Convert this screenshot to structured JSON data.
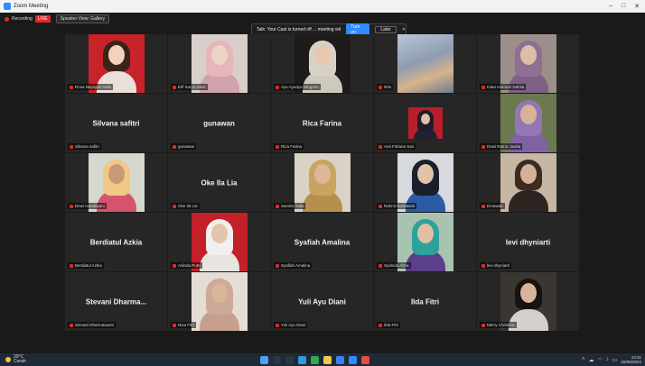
{
  "window": {
    "title": "Zoom Meeting",
    "controls": [
      "–",
      "□",
      "✕"
    ]
  },
  "topbar": {
    "recording_label": "Recording",
    "live_label": "LIVE",
    "view_label": "Speaker View: Gallery"
  },
  "notification": {
    "message": "Talk: Your Cast is turned off ... meeting video",
    "primary_label": "Turn on",
    "secondary_label": "Later",
    "close": "✕"
  },
  "speaker_hint": "",
  "tiles": [
    {
      "name": "",
      "label": "Rosa Naysyas Aulia",
      "video": true,
      "bg": "#c8222a",
      "skin": "#f1d2bd",
      "hair": "#3a2418",
      "hijab": null,
      "cloth": "#e9e0da"
    },
    {
      "name": "",
      "label": "Elif Surya Dewi",
      "video": true,
      "bg": "#d7cfca",
      "skin": "#edd3c3",
      "hair": null,
      "hijab": "#e7b5bb",
      "cloth": "#cfa2ad"
    },
    {
      "name": "",
      "label": "Ayu Ayudya Ningrum",
      "video": true,
      "bg": "#1f1b1a",
      "skin": "#e8c7ae",
      "hair": null,
      "hijab": "#d8d2c6",
      "cloth": "#cfc9bd"
    },
    {
      "name": "",
      "label": "Ikhs",
      "video": true,
      "bg": "#8e9cb2",
      "skin": null,
      "hair": null,
      "hijab": null,
      "cloth": null
    },
    {
      "name": "",
      "label": "Intan Harnum Dahlia",
      "video": true,
      "bg": "#9c8e88",
      "skin": "#ddbea7",
      "hair": null,
      "hijab": "#8f6f94",
      "cloth": "#7e5f86"
    },
    {
      "name": "Silvana safitri",
      "label": "Silvana safitri",
      "video": false
    },
    {
      "name": "gunawan",
      "label": "gunawan",
      "video": false
    },
    {
      "name": "Rica Farina",
      "label": "Rica Farina",
      "video": false
    },
    {
      "name": "",
      "label": "Anti Fitriana Sari",
      "video": true,
      "bg": "#b81f2a",
      "skin": "#e2c1a8",
      "hair": null,
      "hijab": "#1d1d2e",
      "cloth": "#22222e",
      "small": true
    },
    {
      "name": "",
      "label": "Dewi Ratna Juwita",
      "video": true,
      "bg": "#6b7a4e",
      "skin": "#d8b398",
      "hair": null,
      "hijab": "#9476b6",
      "cloth": "#8062a4"
    },
    {
      "name": "",
      "label": "Dewi Handayani",
      "video": true,
      "bg": "#d6d8d0",
      "skin": "#c99a78",
      "hair": null,
      "hijab": "#f1c886",
      "cloth": "#d5546b"
    },
    {
      "name": "Oke Ila Lia",
      "label": "Oke Ila Lia",
      "video": false
    },
    {
      "name": "",
      "label": "Sandra Yulia",
      "video": true,
      "bg": "#d9d3c5",
      "skin": "#dbb899",
      "hair": null,
      "hijab": "#c9a460",
      "cloth": "#b58f4e"
    },
    {
      "name": "",
      "label": "Rahmi Novitasari",
      "video": true,
      "bg": "#d7d9de",
      "skin": "#e2c3aa",
      "hair": null,
      "hijab": "#1a1f2c",
      "cloth": "#2d5aa5"
    },
    {
      "name": "",
      "label": "Ernawati",
      "video": true,
      "bg": "#c7b6a3",
      "skin": "#d4b19a",
      "hair": "#3c2b20",
      "hijab": null,
      "cloth": "#2c2522"
    },
    {
      "name": "Berdiatul Azkia",
      "label": "Berdiatul Azkia",
      "video": false
    },
    {
      "name": "",
      "label": "Adinda Putri",
      "video": true,
      "bg": "#c3202a",
      "skin": "#e3c4ac",
      "hair": null,
      "hijab": "#f2f0ee",
      "cloth": "#e8e4e0"
    },
    {
      "name": "Syafiah Amalina",
      "label": "Syafiah Amalina",
      "video": false
    },
    {
      "name": "",
      "label": "Syahida Aitha",
      "video": true,
      "bg": "#a9c3b1",
      "skin": "#e0bfa5",
      "hair": null,
      "hijab": "#2da19a",
      "cloth": "#5b3f8a"
    },
    {
      "name": "levi dhyniarti",
      "label": "levi dhyniarti",
      "video": false
    },
    {
      "name": "Stevani Dharma...",
      "label": "Stevani Dharmawanti",
      "video": false
    },
    {
      "name": "",
      "label": "Nisa Fitri",
      "video": true,
      "bg": "#e3ddd6",
      "skin": "#d9b497",
      "hair": null,
      "hijab": "#ccaa9a",
      "cloth": "#c79f8f"
    },
    {
      "name": "Yuli Ayu Diani",
      "label": "Yuli Ayu Diani",
      "video": false
    },
    {
      "name": "Ilda Fitri",
      "label": "Ilda Fitri",
      "video": false
    },
    {
      "name": "",
      "label": "Merry Christina",
      "video": true,
      "bg": "#3a3632",
      "skin": "#d7b49a",
      "hair": "#161311",
      "hijab": null,
      "cloth": "#d4d0cc"
    }
  ],
  "taskbar": {
    "weather_temp": "29°C",
    "weather_desc": "Cerah",
    "apps": [
      {
        "name": "start",
        "color": "#4aa3f0"
      },
      {
        "name": "search",
        "color": "#2a3644"
      },
      {
        "name": "taskview",
        "color": "#2a3644"
      },
      {
        "name": "edge",
        "color": "#2e9be0"
      },
      {
        "name": "chrome",
        "color": "#34a853"
      },
      {
        "name": "explorer",
        "color": "#f2c94c"
      },
      {
        "name": "store",
        "color": "#3b82f6"
      },
      {
        "name": "zoom",
        "color": "#2d8cff"
      },
      {
        "name": "mail",
        "color": "#e74c3c"
      }
    ],
    "time": "10:31",
    "date": "29/05/2022"
  }
}
